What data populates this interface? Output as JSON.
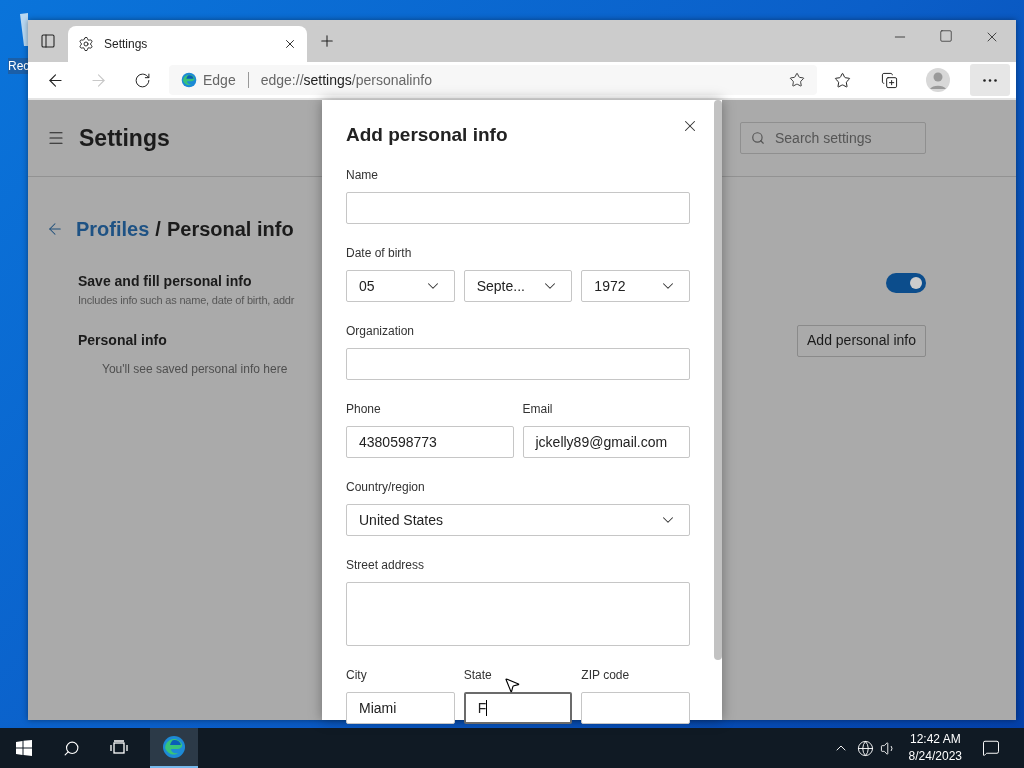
{
  "desktop": {
    "icons": [
      {
        "label": "Rec"
      }
    ]
  },
  "browser": {
    "tabs": [
      {
        "title": "Settings",
        "selected": true
      }
    ],
    "nav": {
      "back_disabled": false,
      "forward_disabled": true
    },
    "address": {
      "badge": "Edge",
      "prefix": "edge://",
      "host": "settings",
      "path": "/personalinfo"
    }
  },
  "page": {
    "title": "Settings",
    "search": {
      "placeholder": "Search settings"
    },
    "breadcrumb": {
      "parent": "Profiles",
      "separator": "/",
      "current": "Personal info"
    },
    "save_fill": {
      "label": "Save and fill personal info",
      "description": "Includes info such as name, date of birth, addr",
      "on": true
    },
    "personal_info": {
      "heading": "Personal info",
      "button": "Add personal info",
      "empty_message": "You'll see saved personal info here"
    }
  },
  "dialog": {
    "title": "Add personal info",
    "rows": [
      {
        "fields": [
          {
            "label": "Name",
            "kind": "text",
            "focused": false
          }
        ]
      },
      {
        "label": "Date of birth",
        "fields": [
          {
            "kind": "select",
            "value": "05",
            "focused": false
          },
          {
            "kind": "select",
            "value": "Septe...",
            "focused": false
          },
          {
            "kind": "select",
            "value": "1972",
            "focused": false
          }
        ]
      },
      {
        "fields": [
          {
            "label": "Organization",
            "kind": "text",
            "focused": false
          }
        ]
      },
      {
        "fields": [
          {
            "label": "Phone",
            "kind": "text",
            "value": "4380598773",
            "focused": false
          },
          {
            "label": "Email",
            "kind": "text",
            "value": "jckelly89@gmail.com",
            "focused": false
          }
        ]
      },
      {
        "fields": [
          {
            "label": "Country/region",
            "kind": "select",
            "value": "United States",
            "focused": false
          }
        ]
      },
      {
        "fields": [
          {
            "label": "Street address",
            "kind": "textarea",
            "focused": false
          }
        ]
      },
      {
        "fields": [
          {
            "label": "City",
            "kind": "text",
            "value": "Miami",
            "focused": false
          },
          {
            "label": "State",
            "kind": "text",
            "value": "F",
            "focused": true
          },
          {
            "label": "ZIP code",
            "kind": "text",
            "focused": false
          }
        ]
      }
    ]
  },
  "taskbar": {
    "pinned": [
      {
        "kind": "edge",
        "selected": true
      }
    ],
    "clock": {
      "time": "12:42 AM",
      "date": "8/24/2023"
    }
  }
}
